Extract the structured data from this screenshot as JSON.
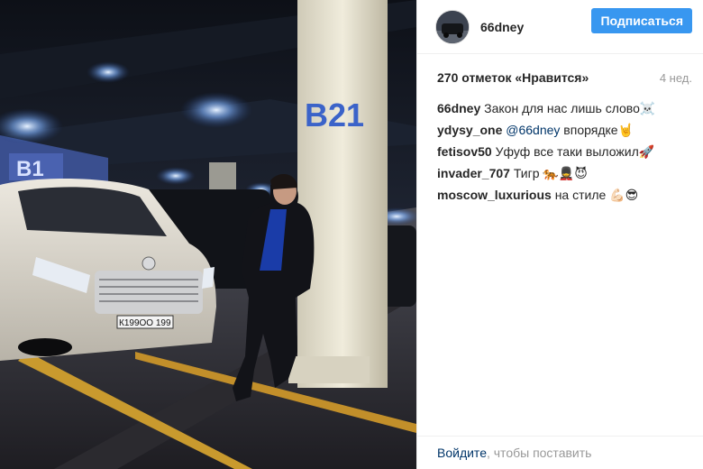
{
  "photo": {
    "alt": "",
    "pillar_text": "B21",
    "plate_text": "К199ОО 199"
  },
  "header": {
    "username": "66dney",
    "follow_label": "Подписаться"
  },
  "meta": {
    "likes": "270 отметок «Нравится»",
    "time": "4 нед."
  },
  "comments": [
    {
      "user": "66dney",
      "mention": "",
      "text": " Закон для нас лишь слово☠️"
    },
    {
      "user": "ydysy_one",
      "mention": " @66dney",
      "text": " впорядке🤘"
    },
    {
      "user": "fetisov50",
      "mention": "",
      "text": " Уфуф все таки выложил🚀"
    },
    {
      "user": "invader_707",
      "mention": "",
      "text": " Тигр 🐅💂😈"
    },
    {
      "user": "moscow_luxurious",
      "mention": "",
      "text": " на стиле 💪🏻😎"
    }
  ],
  "footer": {
    "login_label": "Войдите",
    "rest": ", чтобы поставить"
  },
  "colors": {
    "accent": "#3897f0",
    "link": "#003569",
    "muted": "#999999"
  }
}
